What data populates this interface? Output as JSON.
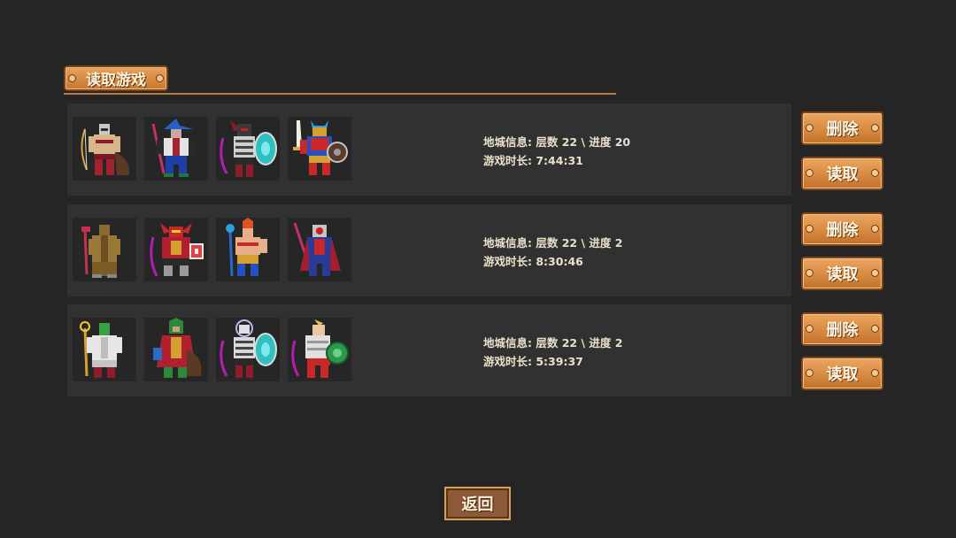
{
  "title": "读取游戏",
  "saves": [
    {
      "info_line1": "地城信息: 层数 22 \\ 进度 20",
      "info_line2": "游戏时长: 7:44:31",
      "heroes": [
        "barbarian-archer",
        "blue-hat-wizard",
        "dark-shield-knight",
        "red-sword-warrior"
      ],
      "delete_label": "删除",
      "load_label": "读取"
    },
    {
      "info_line1": "地城信息: 层数 22 \\ 进度 2",
      "info_line2": "游戏时长: 8:30:46",
      "heroes": [
        "brown-monk",
        "red-demon-knight",
        "fire-mage",
        "crimson-knight"
      ],
      "delete_label": "删除",
      "load_label": "读取"
    },
    {
      "info_line1": "地城信息: 层数 22 \\ 进度 2",
      "info_line2": "游戏时长: 5:39:37",
      "heroes": [
        "white-priest",
        "green-hooded-ranger",
        "skeleton-shield-knight",
        "green-shield-paladin"
      ],
      "delete_label": "删除",
      "load_label": "读取"
    }
  ],
  "back_label": "返回",
  "colors": {
    "background": "#252525",
    "slot": "#313131",
    "button_orange": "#d88a41",
    "back_button": "#8d5a38",
    "divider": "#b87a45"
  }
}
